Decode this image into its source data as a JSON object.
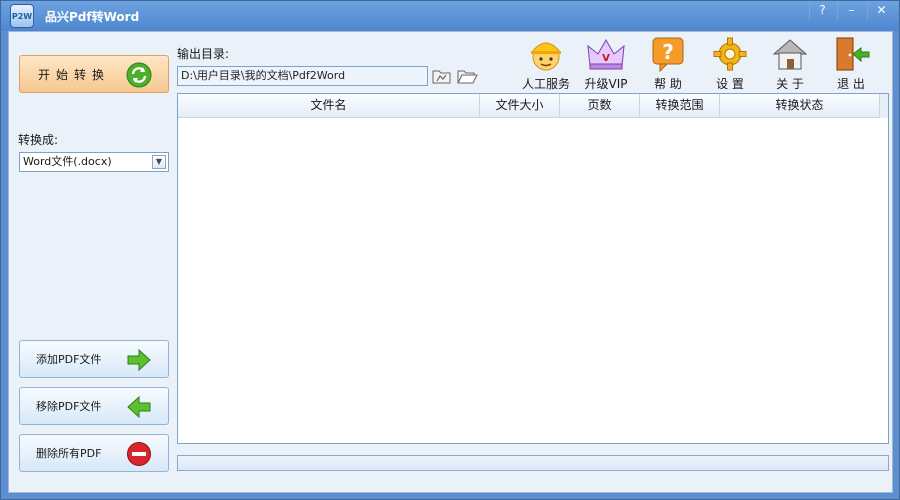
{
  "window": {
    "title": "品兴Pdf转Word",
    "app_icon": "P2W",
    "help_label": "?",
    "min_label": "–",
    "close_label": "✕"
  },
  "left_panel": {
    "start_label": "开始转换",
    "convert_to_label": "转换成:",
    "format_value": "Word文件(.docx)",
    "add_label": "添加PDF文件",
    "remove_label": "移除PDF文件",
    "clear_label": "删除所有PDF"
  },
  "output": {
    "label": "输出目录:",
    "path": "D:\\用户目录\\我的文档\\Pdf2Word"
  },
  "toolbar": {
    "items": [
      {
        "label": "人工服务",
        "icon": "support-worker-icon"
      },
      {
        "label": "升级VIP",
        "icon": "vip-crown-icon"
      },
      {
        "label": "帮  助",
        "icon": "help-icon"
      },
      {
        "label": "设  置",
        "icon": "gear-icon"
      },
      {
        "label": "关  于",
        "icon": "home-icon"
      },
      {
        "label": "退  出",
        "icon": "exit-door-icon"
      }
    ]
  },
  "table": {
    "columns": [
      "文件名",
      "文件大小",
      "页数",
      "转换范围",
      "转换状态"
    ],
    "rows": []
  },
  "progress": {
    "value": 0
  },
  "colors": {
    "accent": "#4d87cf",
    "start_button": "#f6c890",
    "arrow_green": "#4caf2a",
    "stop_red": "#d9262a"
  }
}
